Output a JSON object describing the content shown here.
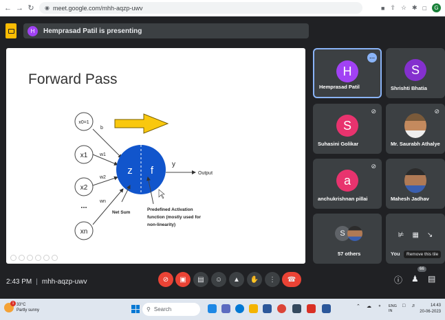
{
  "browser": {
    "url": "meet.google.com/mhh-aqzp-uwv",
    "profile_initial": "G"
  },
  "presenting": {
    "initial": "H",
    "text": "Hemprasad Patil is presenting"
  },
  "slide": {
    "title": "Forward Pass",
    "inputs": [
      "x0=1",
      "x1",
      "x2",
      "xn"
    ],
    "ellipsis": "...",
    "weights": [
      "b",
      "w1",
      "w2",
      "wn"
    ],
    "neuron_z": "z",
    "neuron_f": "f",
    "output_y": "y",
    "output_label": "Output",
    "net_sum_label": "Net Sum",
    "activation_label_lines": [
      "Predefined Activation",
      "function (mostly used for",
      "non-linearity)"
    ],
    "arrow_color": "#f9c80e",
    "neuron_color": "#1155cc"
  },
  "participants": [
    {
      "name": "Hemprasad Patil",
      "initial": "H",
      "color": "#a142f4",
      "active": true
    },
    {
      "name": "Shrishti Bhatia",
      "initial": "S",
      "color": "#8430ce"
    },
    {
      "name": "Suhasini Golikar",
      "initial": "S",
      "color": "#e8336e",
      "muted": true
    },
    {
      "name": "Mr. Saurabh Athalye",
      "photo": true,
      "muted": true
    },
    {
      "name": "anchukrishnan pillai",
      "initial": "a",
      "color": "#e8336e",
      "muted": true
    },
    {
      "name": "Mahesh Jadhav",
      "photo": true
    },
    {
      "name": "57 others",
      "initial": "S",
      "color": "#5f6368"
    },
    {
      "name": "You",
      "tooltip": "Remove this tile"
    }
  ],
  "controls": {
    "time": "2:43 PM",
    "separator": "|",
    "meeting_code": "mhh-aqzp-uwv",
    "people_badge": "66"
  },
  "taskbar": {
    "temperature": "33°C",
    "weather": "Partly sunny",
    "weather_badge": "1",
    "search_placeholder": "Search",
    "lang_line1": "ENG",
    "lang_line2": "IN",
    "time": "14:43",
    "date": "20-06-2023"
  }
}
